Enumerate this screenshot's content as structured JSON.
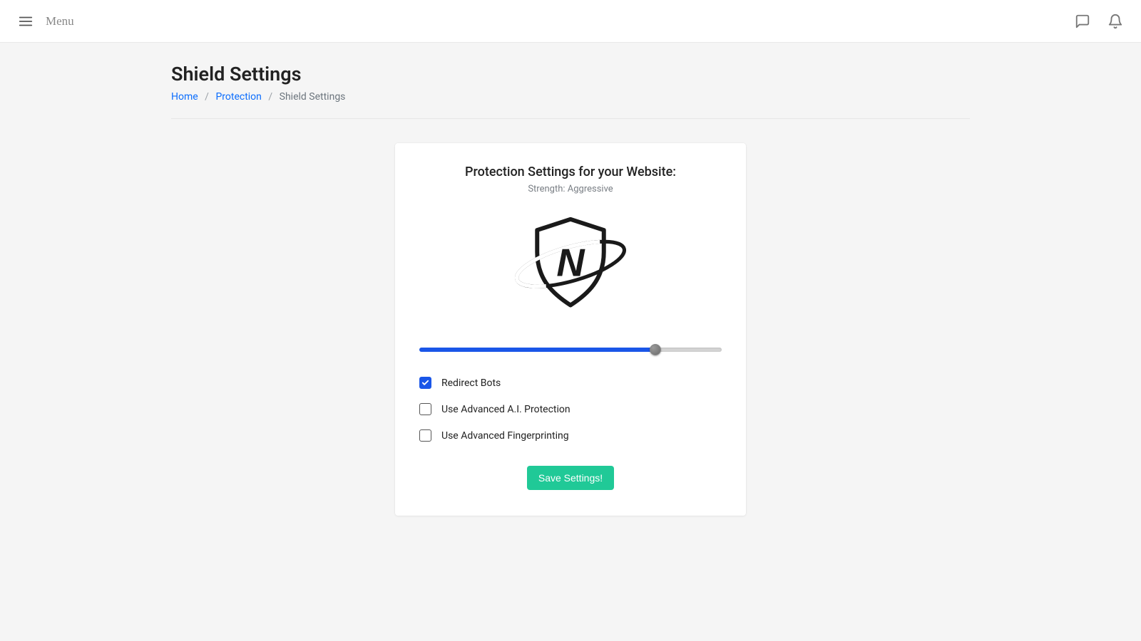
{
  "topbar": {
    "menu_label": "Menu"
  },
  "page": {
    "title": "Shield Settings"
  },
  "breadcrumb": {
    "items": [
      {
        "label": "Home",
        "link": true
      },
      {
        "label": "Protection",
        "link": true
      },
      {
        "label": "Shield Settings",
        "link": false
      }
    ],
    "separator": "/"
  },
  "card": {
    "title": "Protection Settings for your Website:",
    "subtitle_prefix": "Strength: ",
    "strength": "Aggressive",
    "slider": {
      "value_percent": 78
    },
    "checkboxes": [
      {
        "label": "Redirect Bots",
        "checked": true
      },
      {
        "label": "Use Advanced A.I. Protection",
        "checked": false
      },
      {
        "label": "Use Advanced Fingerprinting",
        "checked": false
      }
    ],
    "save_label": "Save Settings!"
  },
  "icons": {
    "hamburger": "hamburger-icon",
    "chat": "chat-icon",
    "bell": "bell-icon"
  },
  "colors": {
    "accent_blue": "#1a56e8",
    "save_green": "#20c997",
    "link_blue": "#0d6efd"
  }
}
